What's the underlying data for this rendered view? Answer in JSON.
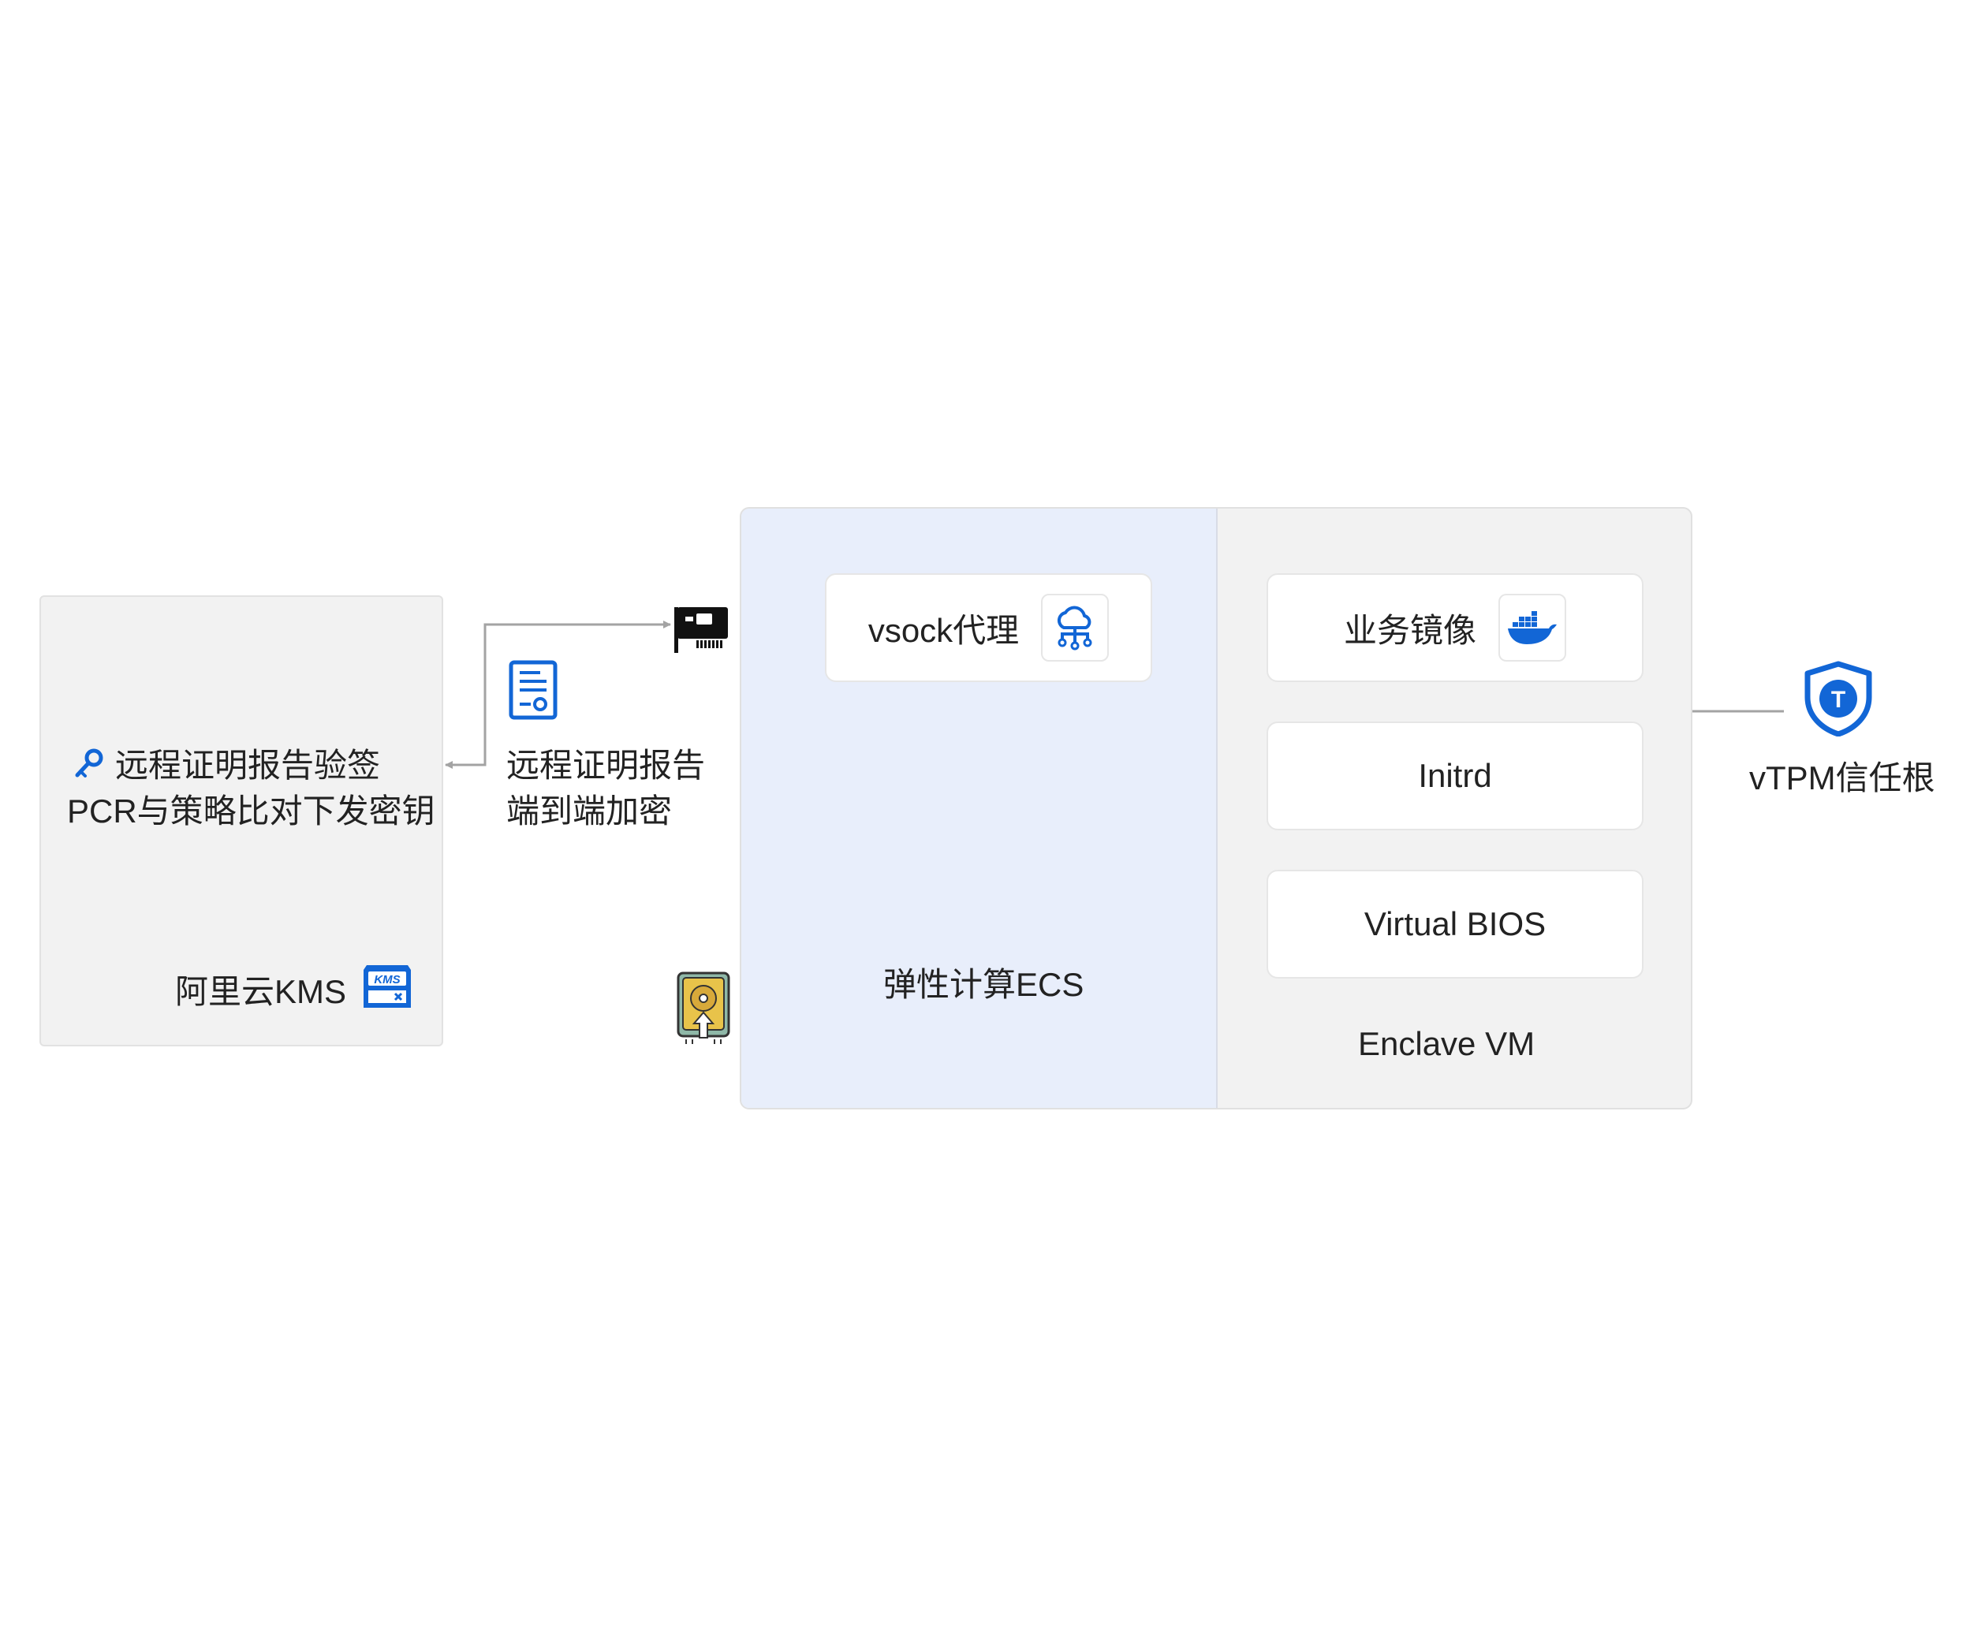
{
  "kms": {
    "line1": "远程证明报告验签",
    "line2": "PCR与策略比对下发密钥",
    "title": "阿里云KMS",
    "badge_text": "KMS",
    "key_icon": "key-icon",
    "kms_icon": "kms-icon"
  },
  "report": {
    "line1": "远程证明报告",
    "line2": "端到端加密",
    "icon": "document-icon"
  },
  "ecs": {
    "title": "弹性计算ECS",
    "nic_icon": "network-card-icon",
    "disk_icon": "disk-icon",
    "vsock": {
      "label": "vsock代理",
      "icon": "cloud-network-icon"
    }
  },
  "enclave": {
    "title": "Enclave VM",
    "image": {
      "label": "业务镜像",
      "icon": "docker-icon"
    },
    "initrd": {
      "label": "Initrd"
    },
    "bios": {
      "label": "Virtual BIOS"
    }
  },
  "vtpm": {
    "label": "vTPM信任根",
    "badge_text": "T",
    "icon": "shield-icon"
  },
  "colors": {
    "accent_blue": "#1266d6",
    "arrow_gray": "#a3a3a3",
    "panel_gray": "#f2f2f2",
    "panel_blue": "#e8eefb"
  }
}
